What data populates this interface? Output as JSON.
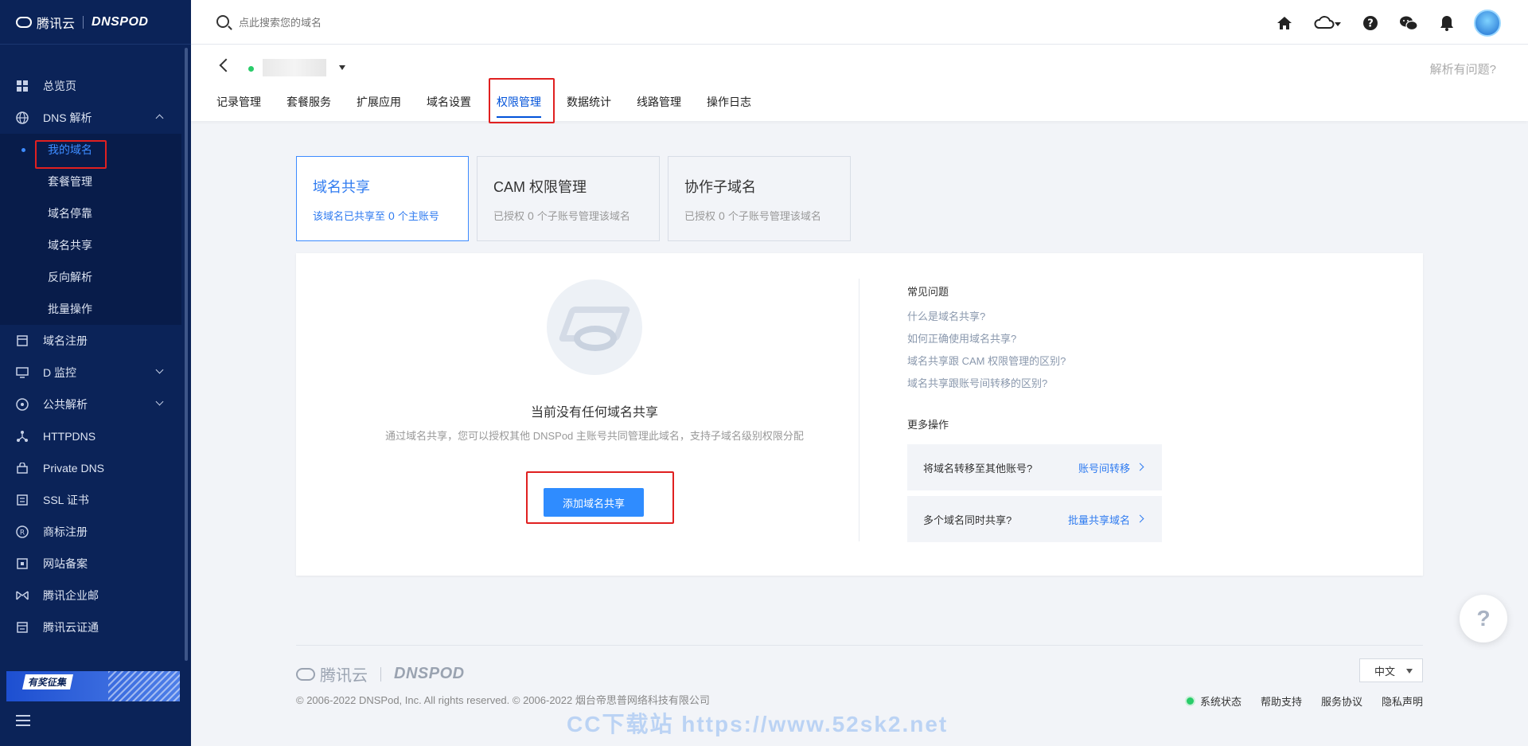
{
  "sidebar": {
    "brand": "腾讯云",
    "brand2": "DNSPOD",
    "items": [
      {
        "label": "总览页",
        "icon": "grid-icon"
      },
      {
        "label": "DNS 解析",
        "icon": "globe-icon"
      }
    ],
    "dns_sub": [
      {
        "label": "我的域名"
      },
      {
        "label": "套餐管理"
      },
      {
        "label": "域名停靠"
      },
      {
        "label": "域名共享"
      },
      {
        "label": "反向解析"
      },
      {
        "label": "批量操作"
      }
    ],
    "items2": [
      {
        "label": "域名注册",
        "icon": "register-icon"
      },
      {
        "label": "D 监控",
        "icon": "monitor-icon"
      },
      {
        "label": "公共解析",
        "icon": "public-dns-icon"
      },
      {
        "label": "HTTPDNS",
        "icon": "httpdns-icon"
      },
      {
        "label": "Private DNS",
        "icon": "private-dns-icon"
      },
      {
        "label": "SSL 证书",
        "icon": "ssl-icon"
      },
      {
        "label": "商标注册",
        "icon": "trademark-icon"
      },
      {
        "label": "网站备案",
        "icon": "filing-icon"
      },
      {
        "label": "腾讯企业邮",
        "icon": "mail-icon"
      },
      {
        "label": "腾讯云证通",
        "icon": "cert-icon"
      }
    ],
    "banner_tag": "有奖征集"
  },
  "topbar": {
    "search_placeholder": "点此搜索您的域名"
  },
  "header": {
    "help_link": "解析有问题?",
    "tabs": [
      {
        "label": "记录管理"
      },
      {
        "label": "套餐服务"
      },
      {
        "label": "扩展应用"
      },
      {
        "label": "域名设置"
      },
      {
        "label": "权限管理"
      },
      {
        "label": "数据统计"
      },
      {
        "label": "线路管理"
      },
      {
        "label": "操作日志"
      }
    ]
  },
  "cards": [
    {
      "title": "域名共享",
      "pre": "该域名已共享至",
      "count": "0",
      "post": "个主账号"
    },
    {
      "title": "CAM 权限管理",
      "pre": "已授权",
      "count": "0",
      "post": "个子账号管理该域名"
    },
    {
      "title": "协作子域名",
      "pre": "已授权",
      "count": "0",
      "post": "个子账号管理该域名"
    }
  ],
  "empty": {
    "title": "当前没有任何域名共享",
    "desc": "通过域名共享，您可以授权其他 DNSPod 主账号共同管理此域名，支持子域名级别权限分配",
    "button": "添加域名共享"
  },
  "faq": {
    "title": "常见问题",
    "links": [
      "什么是域名共享?",
      "如何正确使用域名共享?",
      "域名共享跟 CAM 权限管理的区别?",
      "域名共享跟账号间转移的区别?"
    ]
  },
  "more": {
    "title": "更多操作",
    "ops": [
      {
        "text": "将域名转移至其他账号?",
        "link": "账号间转移"
      },
      {
        "text": "多个域名同时共享?",
        "link": "批量共享域名"
      }
    ]
  },
  "footer": {
    "brand": "腾讯云",
    "brand2": "DNSPOD",
    "copyright": "© 2006-2022 DNSPod, Inc. All rights reserved. © 2006-2022 烟台帝思普网络科技有限公司",
    "lang": "中文",
    "links": [
      "系统状态",
      "帮助支持",
      "服务协议",
      "隐私声明"
    ],
    "watermark": "CC下载站 https://www.52sk2.net"
  }
}
